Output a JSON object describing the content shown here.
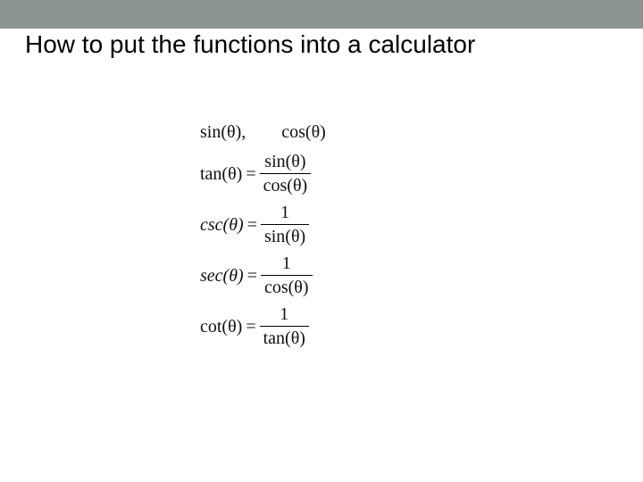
{
  "title": "How to put the functions into a calculator",
  "row0": {
    "sin": "sin(θ)",
    "comma": ",",
    "cos": "cos(θ)"
  },
  "tan": {
    "lhs": "tan(θ)",
    "num": "sin(θ)",
    "den": "cos(θ)"
  },
  "csc": {
    "lhs": "csc(θ)",
    "num": "1",
    "den": "sin(θ)"
  },
  "sec": {
    "lhs": "sec(θ)",
    "num": "1",
    "den": "cos(θ)"
  },
  "cot": {
    "lhs": "cot(θ)",
    "num": "1",
    "den": "tan(θ)"
  },
  "eq": "="
}
